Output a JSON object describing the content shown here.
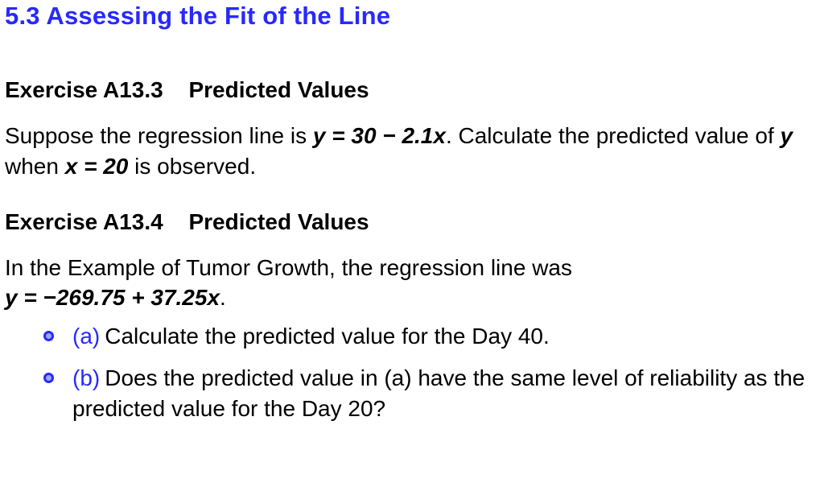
{
  "section": {
    "number": "5.3",
    "title": "Assessing the Fit of the Line"
  },
  "exercises": [
    {
      "label": "Exercise A13.3",
      "title": "Predicted Values",
      "prose_pre": "Suppose the regression line is ",
      "equation": "y = 30 − 2.1x",
      "prose_mid": ". Calculate the predicted value of ",
      "var_y": "y",
      "prose_when": " when ",
      "cond": "x = 20",
      "prose_post": " is observed."
    },
    {
      "label": "Exercise A13.4",
      "title": "Predicted Values",
      "prose_pre": "In the Example of Tumor Growth, the regression line was ",
      "equation": "y = −269.75 + 37.25x",
      "prose_post": ".",
      "parts": [
        {
          "label": "(a)",
          "text": "Calculate the predicted value for the Day 40."
        },
        {
          "label": "(b)",
          "text": "Does the predicted value in (a) have the same level of reliability as the predicted value for the Day 20?"
        }
      ]
    }
  ]
}
